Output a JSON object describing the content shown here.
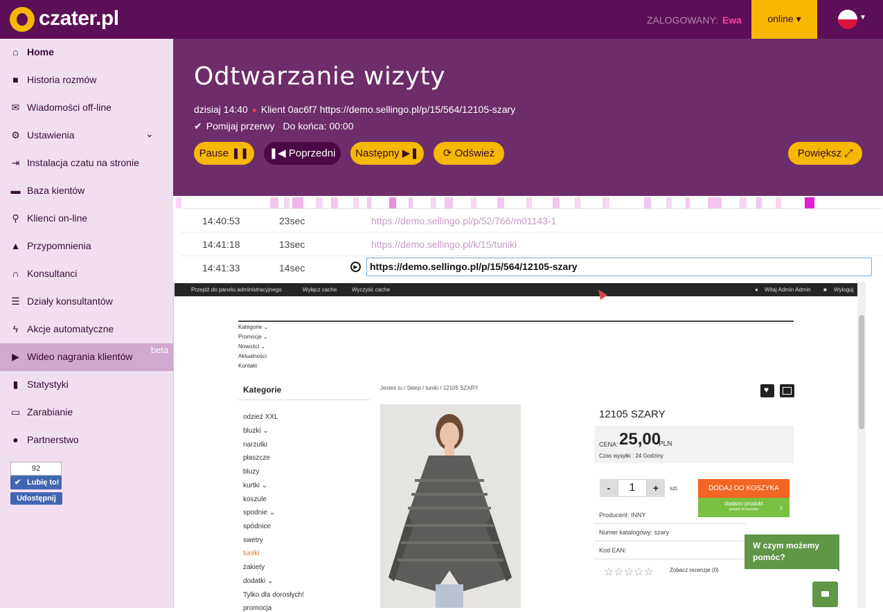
{
  "header": {
    "logo_text": "czater.pl",
    "logged_label": "ZALOGOWANY:",
    "logged_user": "Ewa",
    "status": "online ▾",
    "flag": "poland-flag"
  },
  "sidebar": {
    "items": [
      {
        "label": "Home",
        "icon": "home-icon",
        "glyph": "⌂"
      },
      {
        "label": "Historia rozmów",
        "icon": "comment-icon",
        "glyph": "■"
      },
      {
        "label": "Wiadomości off-line",
        "icon": "envelope-icon",
        "glyph": "✉"
      },
      {
        "label": "Ustawienia",
        "icon": "gear-icon",
        "glyph": "⚙"
      },
      {
        "label": "Instalacja czatu na stronie",
        "icon": "sign-in-icon",
        "glyph": "⇥"
      },
      {
        "label": "Baza kientów",
        "icon": "folder-icon",
        "glyph": "▬"
      },
      {
        "label": "Klienci on-line",
        "icon": "search-icon",
        "glyph": "⚲"
      },
      {
        "label": "Przypomnienia",
        "icon": "bell-icon",
        "glyph": "▲"
      },
      {
        "label": "Konsultanci",
        "icon": "headphones-icon",
        "glyph": "∩"
      },
      {
        "label": "Działy konsultantów",
        "icon": "list-icon",
        "glyph": "☰"
      },
      {
        "label": "Akcje automatyczne",
        "icon": "bolt-icon",
        "glyph": "ϟ"
      },
      {
        "label": "Wideo nagrania klientów",
        "icon": "play-circle-icon",
        "glyph": "▶",
        "badge": "beta"
      },
      {
        "label": "Statystyki",
        "icon": "bar-chart-icon",
        "glyph": "▮"
      },
      {
        "label": "Zarabianie",
        "icon": "credit-card-icon",
        "glyph": "▭"
      },
      {
        "label": "Partnerstwo",
        "icon": "piggy-bank-icon",
        "glyph": "●"
      }
    ],
    "like_count": "92",
    "like_label": "Lubię to!",
    "share_label": "Udostępnij"
  },
  "page": {
    "title": "Odtwarzanie wizyty",
    "meta_date": "dzisiaj 14:40",
    "meta_client": "Klient 0ac6f7",
    "meta_url": "https://demo.sellingo.pl/p/15/564/12105-szary",
    "skip_breaks": "Pomijaj przerwy",
    "remaining": "Do końca: 00:00",
    "buttons": {
      "pause": "Pause ❚❚",
      "prev": "❚◀ Poprzedni",
      "next": "Następny ▶❚",
      "refresh": "⟳ Odśwież",
      "zoom": "Powiększ ⤢"
    }
  },
  "timeline": [
    {
      "time": "14:40:53",
      "duration": "23sec",
      "url": "https://demo.sellingo.pl/p/52/766/m01143-1"
    },
    {
      "time": "14:41:18",
      "duration": "13sec",
      "url": "https://demo.sellingo.pl/k/15/tuniki"
    },
    {
      "time": "14:41:33",
      "duration": "14sec",
      "url": "https://demo.sellingo.pl/p/15/564/12105-szary"
    }
  ],
  "shop": {
    "admin_bar": [
      "Przejdź do panelu administracyjnego",
      "Wyłącz cache",
      "Wyczyść cache",
      "Witaj Admin Admin",
      "Wyloguj"
    ],
    "nav": [
      "Kategorie",
      "Promocje",
      "Nowości",
      "Aktualności",
      "Kontakt"
    ],
    "category_header": "Kategorie",
    "categories": [
      "odzież XXL",
      "bluzki",
      "narzutki",
      "płaszcze",
      "bluzy",
      "kurtki",
      "koszule",
      "spodnie",
      "spódnice",
      "swetry",
      "tuniki",
      "żakiety",
      "dodatki",
      "Tylko dla dorosłych!",
      "promocja"
    ],
    "breadcrumb": "Jesteś tu   /   Sklep   /   tuniki   /   12105 SZARY",
    "product_title": "12105 SZARY",
    "price_label": "CENA:",
    "price": "25,00",
    "currency": "PLN",
    "shipping": "Czas wysyłki : 24 Godziny",
    "qty": "1",
    "unit": "szt.",
    "add_to_cart": "DODAJ DO KOSZYKA",
    "added": "dodano produkt",
    "added_sub": "przejdź do koszyka",
    "producer": "Producent: INNY",
    "catalog_no": "Numer katalogowy: szary",
    "ean": "Kod EAN:",
    "reviews": "Zobacz recenzje (0)",
    "stars": "☆☆☆☆☆"
  },
  "chat_widget": {
    "bubble": "W czym możemy pomóc?"
  }
}
